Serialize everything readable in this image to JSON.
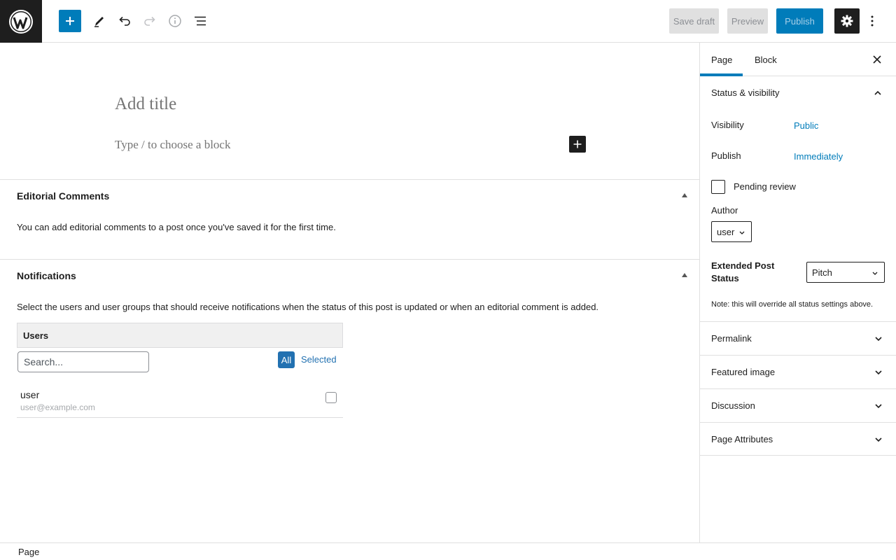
{
  "toolbar": {
    "logo": "wordpress-logo",
    "add_block": "plus-icon",
    "tools": "pencil-icon",
    "undo": "undo-icon",
    "redo": "redo-icon",
    "details": "info-icon",
    "list_view": "list-view-icon",
    "save_draft": "Save draft",
    "preview": "Preview",
    "publish": "Publish",
    "settings": "gear-icon",
    "options": "vertical-ellipsis-icon"
  },
  "editor": {
    "title_placeholder": "Add title",
    "block_placeholder": "Type / to choose a block"
  },
  "editorial_comments": {
    "title": "Editorial Comments",
    "text": "You can add editorial comments to a post once you've saved it for the first time."
  },
  "notifications": {
    "title": "Notifications",
    "text": "Select the users and user groups that should receive notifications when the status of this post is updated or when an editorial comment is added.",
    "users_header": "Users",
    "search_placeholder": "Search...",
    "filter_all": "All",
    "filter_selected": "Selected",
    "users": [
      {
        "name": "user",
        "email": "user@example.com",
        "checked": false
      }
    ]
  },
  "sidebar": {
    "tabs": [
      {
        "label": "Page",
        "active": true
      },
      {
        "label": "Block",
        "active": false
      }
    ],
    "status_visibility": {
      "title": "Status & visibility",
      "visibility_label": "Visibility",
      "visibility_value": "Public",
      "publish_label": "Publish",
      "publish_value": "Immediately",
      "pending_review": "Pending review",
      "author_label": "Author",
      "author_value": "user",
      "extended_label": "Extended Post Status",
      "extended_value": "Pitch",
      "note": "Note: this will override all status settings above."
    },
    "panels": [
      {
        "title": "Permalink"
      },
      {
        "title": "Featured image"
      },
      {
        "title": "Discussion"
      },
      {
        "title": "Page Attributes"
      }
    ]
  },
  "footer": {
    "breadcrumb": "Page"
  },
  "colors": {
    "accent": "#007cba",
    "dark": "#1e1e1e",
    "border": "#e0e0e0"
  }
}
